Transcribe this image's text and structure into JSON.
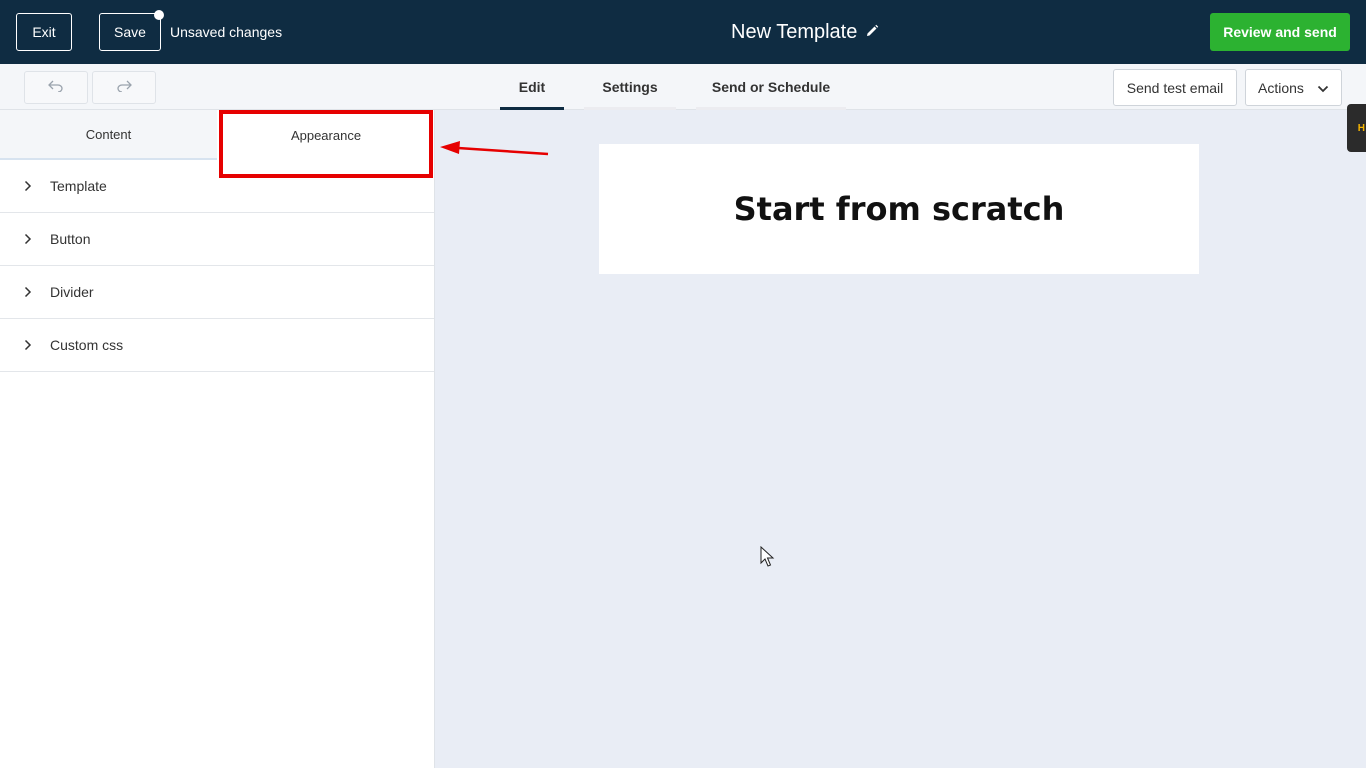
{
  "topbar": {
    "exit_label": "Exit",
    "save_label": "Save",
    "unsaved_text": "Unsaved changes",
    "title": "New Template",
    "review_label": "Review and send",
    "review_color": "#2cb231",
    "background_color": "#0f2c42"
  },
  "toolbar": {
    "tabs": [
      {
        "label": "Edit",
        "active": true
      },
      {
        "label": "Settings",
        "active": false
      },
      {
        "label": "Send or Schedule",
        "active": false
      }
    ],
    "send_test_label": "Send test email",
    "actions_label": "Actions"
  },
  "left_panel": {
    "tabs": [
      {
        "label": "Content",
        "active": false
      },
      {
        "label": "Appearance",
        "active": true
      }
    ],
    "sections": [
      {
        "label": "Template"
      },
      {
        "label": "Button"
      },
      {
        "label": "Divider"
      },
      {
        "label": "Custom css"
      }
    ]
  },
  "canvas": {
    "heading": "Start from scratch"
  },
  "side_widget": {
    "label": "H"
  },
  "annotation": {
    "color": "#e60000"
  }
}
